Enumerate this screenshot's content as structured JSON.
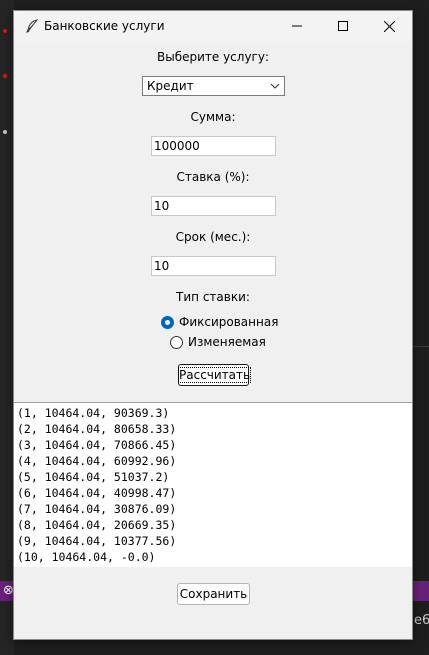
{
  "window": {
    "title": "Банковские услуги"
  },
  "form": {
    "service_label": "Выберите услугу:",
    "service_value": "Кредит",
    "amount_label": "Сумма:",
    "amount_value": "100000",
    "rate_label": "Ставка (%):",
    "rate_value": "10",
    "term_label": "Срок (мес.):",
    "term_value": "10",
    "rate_type_label": "Тип ставки:",
    "rate_options": [
      {
        "label": "Фиксированная",
        "selected": true
      },
      {
        "label": "Изменяемая",
        "selected": false
      }
    ],
    "calculate_label": "Рассчитать"
  },
  "results": [
    "(1, 10464.04, 90369.3)",
    "(2, 10464.04, 80658.33)",
    "(3, 10464.04, 70866.45)",
    "(4, 10464.04, 60992.96)",
    "(5, 10464.04, 51037.2)",
    "(6, 10464.04, 40998.47)",
    "(7, 10464.04, 30876.09)",
    "(8, 10464.04, 20669.35)",
    "(9, 10464.04, 10377.56)",
    "(10, 10464.04, -0.0)"
  ],
  "save_label": "Сохранить",
  "background": {
    "right_edge_text": "е6"
  },
  "colors": {
    "accent": "#0067c0",
    "statusbar": "#68217a"
  }
}
